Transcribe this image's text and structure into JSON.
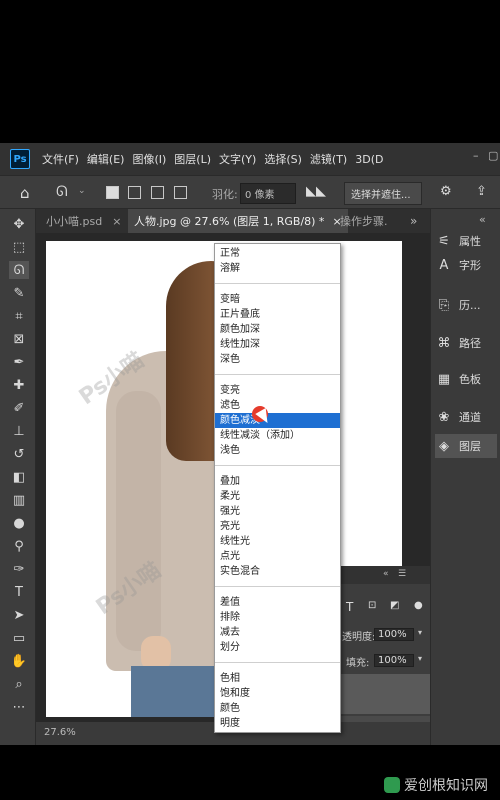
{
  "menubar": {
    "logo": "Ps",
    "items": [
      "文件(F)",
      "编辑(E)",
      "图像(I)",
      "图层(L)",
      "文字(Y)",
      "选择(S)",
      "滤镜(T)",
      "3D(D"
    ]
  },
  "options": {
    "feather_label": "羽化:",
    "feather_value": "0 像素",
    "select_mask_button": "选择并遮住..."
  },
  "tabs": [
    {
      "label": "小小喵.psd",
      "close": "×"
    },
    {
      "label": "人物.jpg @ 27.6% (图层 1, RGB/8) *",
      "close": "×"
    },
    {
      "label": "操作步骤.",
      "close": ""
    }
  ],
  "tabs_overflow": "»",
  "status": {
    "zoom": "27.6%"
  },
  "watermark": {
    "text1": "Ps小喵",
    "text2": "Ps小喵"
  },
  "right_panel": {
    "items": [
      {
        "icon": "properties-icon",
        "glyph": "⚟",
        "label": "属性"
      },
      {
        "icon": "character-icon",
        "glyph": "A",
        "label": "字形"
      },
      {
        "icon": "history-icon",
        "glyph": "⎘",
        "label": "历..."
      },
      {
        "icon": "paths-icon",
        "glyph": "⌘",
        "label": "路径"
      },
      {
        "icon": "swatches-icon",
        "glyph": "▦",
        "label": "色板"
      },
      {
        "icon": "channels-icon",
        "glyph": "❀",
        "label": "通道"
      },
      {
        "icon": "layers-icon",
        "glyph": "◈",
        "label": "图层"
      }
    ]
  },
  "layers_panel": {
    "opacity_label": "透明度:",
    "opacity_value": "100%",
    "fill_label": "填充:",
    "fill_value": "100%"
  },
  "blend_menu": {
    "groups": [
      [
        "正常",
        "溶解"
      ],
      [
        "变暗",
        "正片叠底",
        "颜色加深",
        "线性加深",
        "深色"
      ],
      [
        "变亮",
        "滤色",
        "颜色减淡",
        "线性减淡（添加）",
        "浅色"
      ],
      [
        "叠加",
        "柔光",
        "强光",
        "亮光",
        "线性光",
        "点光",
        "实色混合"
      ],
      [
        "差值",
        "排除",
        "减去",
        "划分"
      ],
      [
        "色相",
        "饱和度",
        "颜色",
        "明度"
      ]
    ],
    "highlighted": "颜色减淡"
  },
  "site_watermark": "爱创根知识网",
  "colors": {
    "highlight": "#1e6fd2",
    "ps_blue": "#31a8ff"
  }
}
